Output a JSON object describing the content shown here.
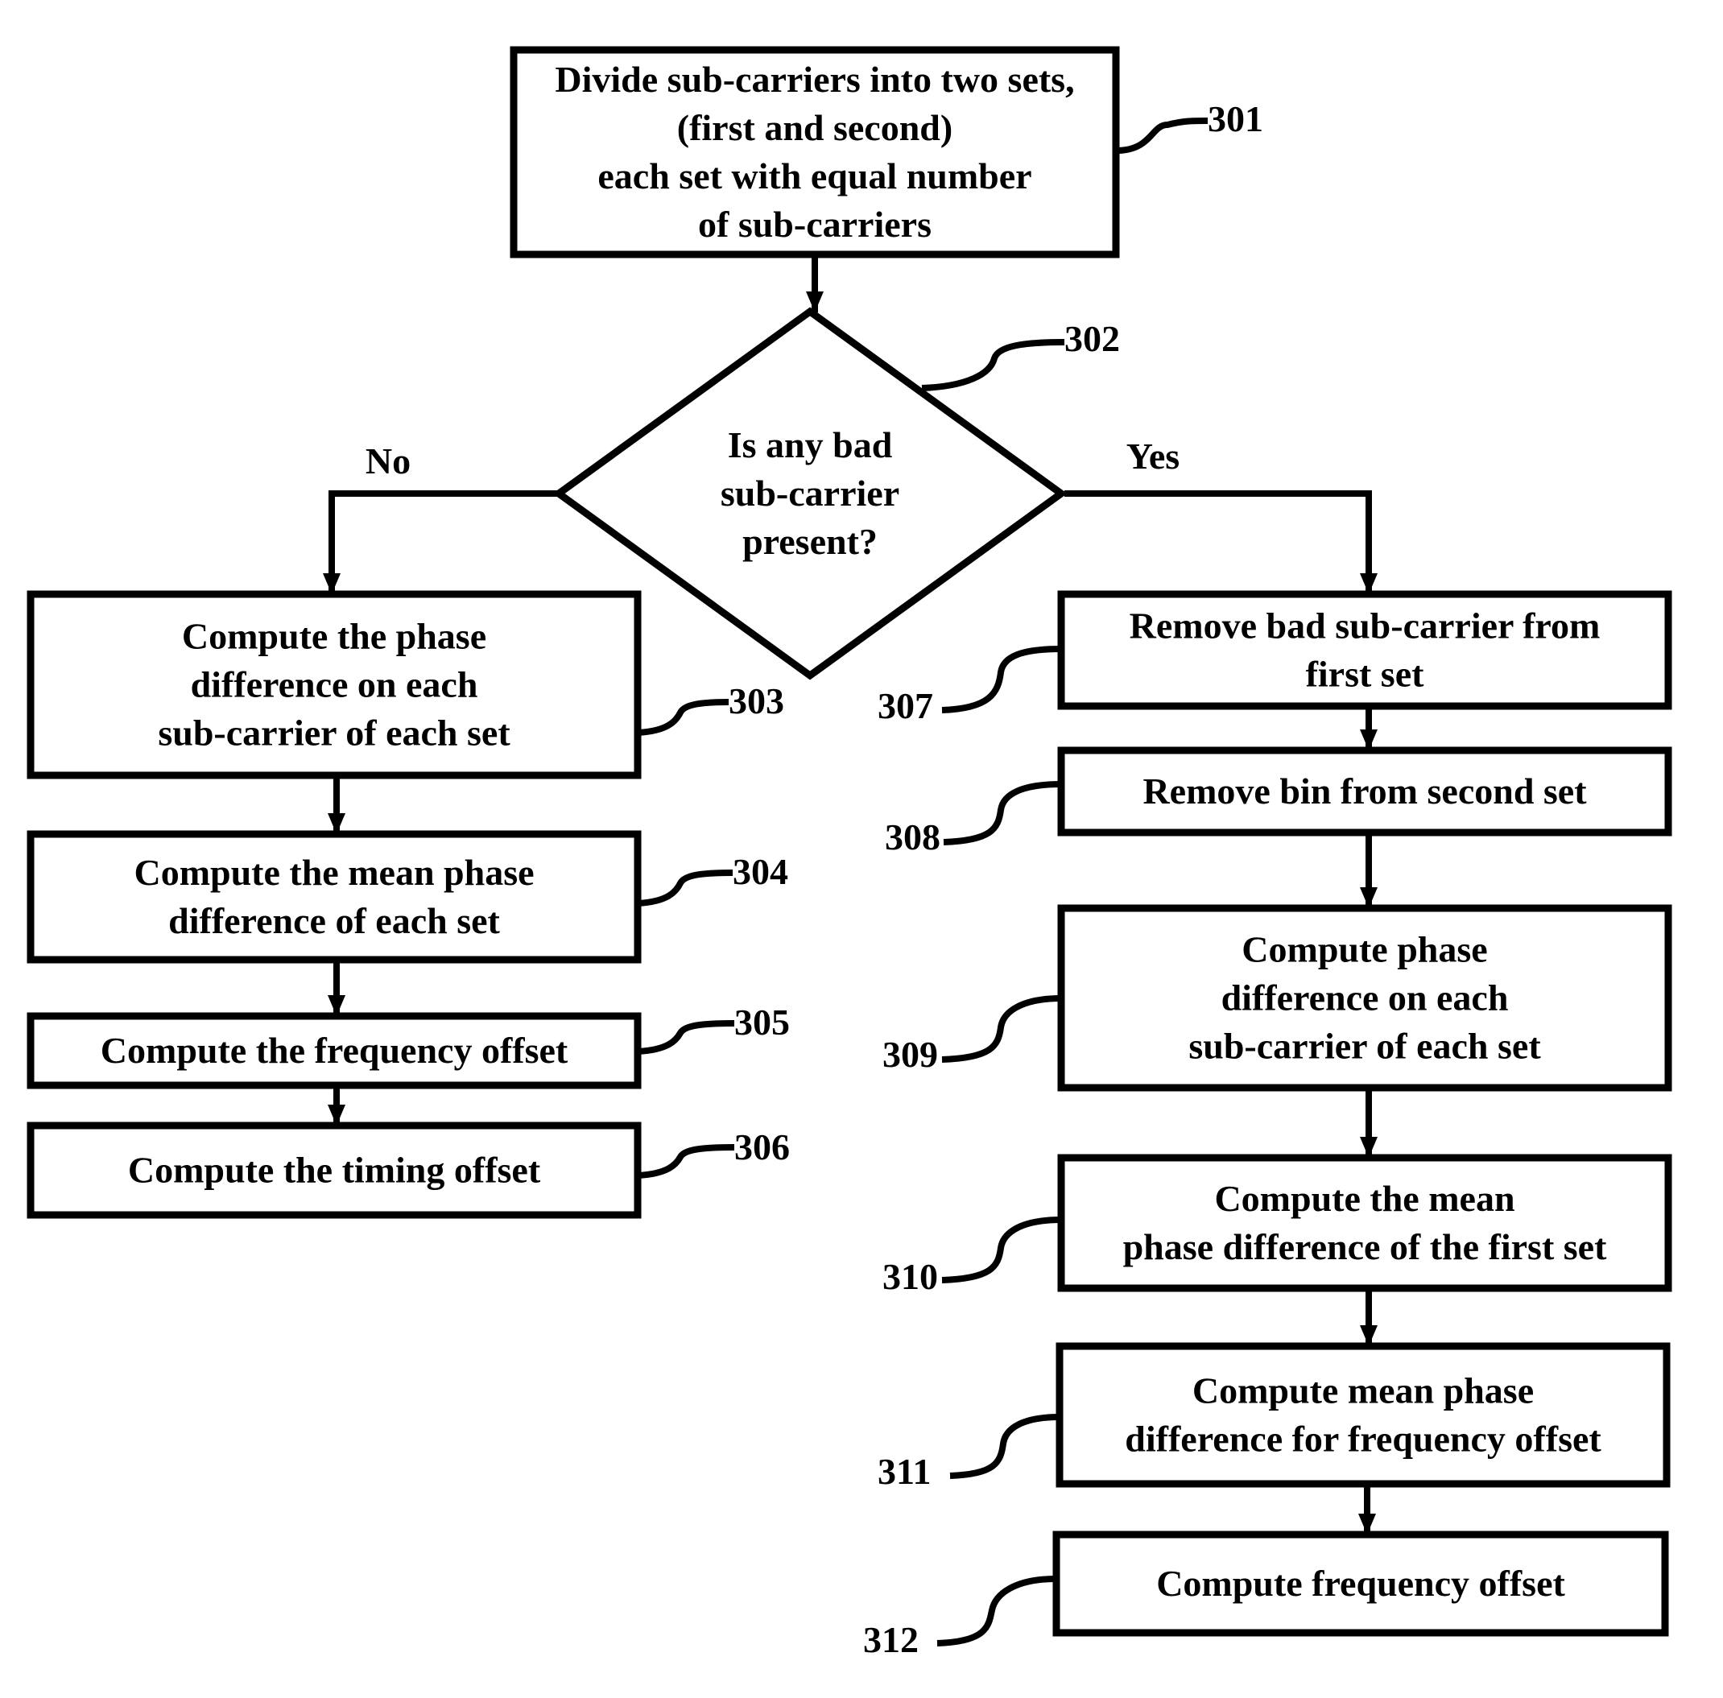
{
  "diagram": {
    "type": "flowchart",
    "nodes": [
      {
        "id": "301",
        "shape": "process",
        "lines": [
          "Divide sub-carriers into two sets,",
          "(first and second)",
          "each set with equal number",
          "of sub-carriers"
        ]
      },
      {
        "id": "302",
        "shape": "decision",
        "lines": [
          "Is any bad",
          "sub-carrier",
          "present?"
        ]
      },
      {
        "id": "303",
        "shape": "process",
        "lines": [
          "Compute the phase",
          "difference on each",
          "sub-carrier of each set"
        ]
      },
      {
        "id": "304",
        "shape": "process",
        "lines": [
          "Compute the mean phase",
          "difference of each set"
        ]
      },
      {
        "id": "305",
        "shape": "process",
        "lines": [
          "Compute the frequency offset"
        ]
      },
      {
        "id": "306",
        "shape": "process",
        "lines": [
          "Compute the timing offset"
        ]
      },
      {
        "id": "307",
        "shape": "process",
        "lines": [
          "Remove bad sub-carrier from",
          "first set"
        ]
      },
      {
        "id": "308",
        "shape": "process",
        "lines": [
          "Remove bin from second set"
        ]
      },
      {
        "id": "309",
        "shape": "process",
        "lines": [
          "Compute phase",
          "difference on each",
          "sub-carrier of each set"
        ]
      },
      {
        "id": "310",
        "shape": "process",
        "lines": [
          "Compute the mean",
          "phase difference of the first set"
        ]
      },
      {
        "id": "311",
        "shape": "process",
        "lines": [
          "Compute mean phase",
          "difference for frequency offset"
        ]
      },
      {
        "id": "312",
        "shape": "process",
        "lines": [
          "Compute frequency offset"
        ]
      }
    ],
    "edges": [
      {
        "from": "301",
        "to": "302",
        "label": ""
      },
      {
        "from": "302",
        "to": "303",
        "label": "No"
      },
      {
        "from": "302",
        "to": "307",
        "label": "Yes"
      },
      {
        "from": "303",
        "to": "304",
        "label": ""
      },
      {
        "from": "304",
        "to": "305",
        "label": ""
      },
      {
        "from": "305",
        "to": "306",
        "label": ""
      },
      {
        "from": "307",
        "to": "308",
        "label": ""
      },
      {
        "from": "308",
        "to": "309",
        "label": ""
      },
      {
        "from": "309",
        "to": "310",
        "label": ""
      },
      {
        "from": "310",
        "to": "311",
        "label": ""
      },
      {
        "from": "311",
        "to": "312",
        "label": ""
      }
    ],
    "branch_labels": {
      "no": "No",
      "yes": "Yes"
    },
    "colors": {
      "stroke": "#000000",
      "background": "#ffffff",
      "text": "#000000"
    }
  }
}
